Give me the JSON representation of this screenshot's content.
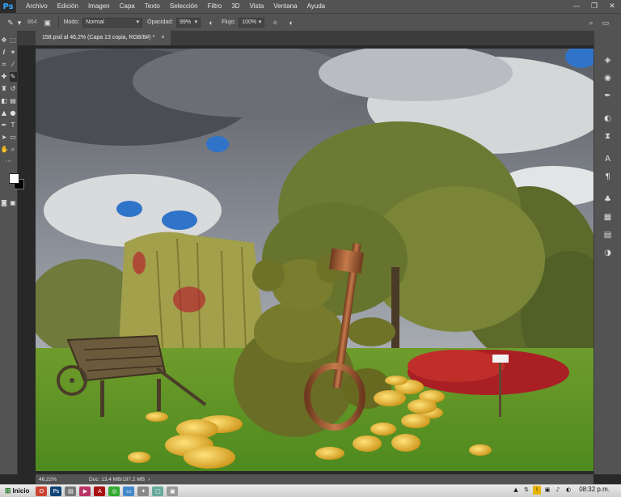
{
  "app": {
    "logo": "Ps"
  },
  "menu": [
    "Archivo",
    "Edición",
    "Imagen",
    "Capa",
    "Texto",
    "Selección",
    "Filtro",
    "3D",
    "Vista",
    "Ventana",
    "Ayuda"
  ],
  "window_controls": {
    "minimize": "—",
    "maximize": "❐",
    "close": "✕"
  },
  "options": {
    "brush_size": "864",
    "mode_label": "Modo:",
    "mode_value": "Normal",
    "opacity_label": "Opacidad:",
    "opacity_value": "99%",
    "flow_label": "Flujo:",
    "flow_value": "100%"
  },
  "document": {
    "tab_title": "158.psd al 46,2% (Capa 13 copia, RGB/8#) *",
    "close": "×"
  },
  "status": {
    "zoom": "46,22%",
    "doc_info": "Doc: 13,4 MB/197,2 MB"
  },
  "taskbar": {
    "start": "Inicio",
    "clock": "08:32 p.m."
  },
  "icons": {
    "tools": [
      "move-icon",
      "marquee-icon",
      "lasso-icon",
      "magic-wand-icon",
      "crop-icon",
      "eyedropper-icon",
      "healing-icon",
      "brush-icon",
      "stamp-icon",
      "history-brush-icon",
      "eraser-icon",
      "gradient-icon",
      "blur-icon",
      "dodge-icon",
      "pen-icon",
      "type-icon",
      "path-select-icon",
      "rectangle-icon",
      "hand-icon",
      "zoom-icon"
    ],
    "right": [
      "layers-icon",
      "channels-icon",
      "paths-icon",
      "adjustments-icon",
      "history-icon",
      "character-icon",
      "paragraph-icon",
      "styles-icon",
      "swatches-icon",
      "properties-icon",
      "color-icon"
    ]
  },
  "colors": {
    "foreground": "#ffffff",
    "background": "#000000",
    "accent": "#31a8ff"
  }
}
